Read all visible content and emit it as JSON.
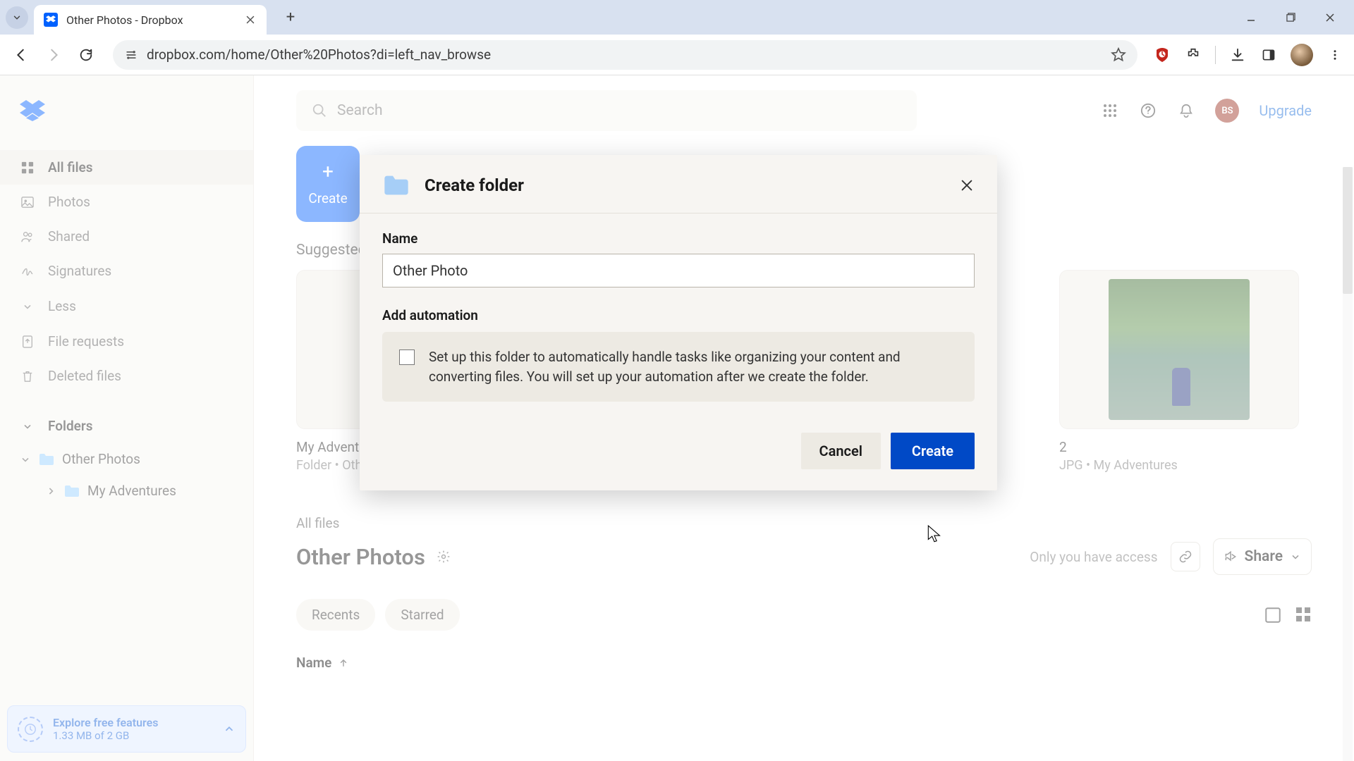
{
  "browser": {
    "tab_title": "Other Photos - Dropbox",
    "url": "dropbox.com/home/Other%20Photos?di=left_nav_browse"
  },
  "sidebar": {
    "items": [
      {
        "label": "All files"
      },
      {
        "label": "Photos"
      },
      {
        "label": "Shared"
      },
      {
        "label": "Signatures"
      }
    ],
    "less_label": "Less",
    "extra": [
      {
        "label": "File requests"
      },
      {
        "label": "Deleted files"
      }
    ],
    "folders_label": "Folders",
    "tree": {
      "root": "Other Photos",
      "child": "My Adventures"
    },
    "promo": {
      "title": "Explore free features",
      "sub": "1.33 MB of 2 GB"
    }
  },
  "topbar": {
    "search_placeholder": "Search",
    "avatar_initials": "BS",
    "upgrade": "Upgrade"
  },
  "content": {
    "create_label": "Create",
    "suggested_label": "Suggested",
    "cards": [
      {
        "title": "My Adventures",
        "sub": "Folder • Other Photos"
      },
      {
        "title": "2",
        "sub": "JPG • My Adventures"
      }
    ],
    "all_files_crumb": "All files",
    "folder_title": "Other Photos",
    "access_text": "Only you have access",
    "share_label": "Share",
    "filters": [
      {
        "label": "Recents"
      },
      {
        "label": "Starred"
      }
    ],
    "col_name": "Name"
  },
  "modal": {
    "title": "Create folder",
    "name_label": "Name",
    "name_value": "Other Photo",
    "auto_label": "Add automation",
    "auto_text": "Set up this folder to automatically handle tasks like organizing your content and converting files. You will set up your automation after we create the folder.",
    "cancel": "Cancel",
    "create": "Create"
  }
}
